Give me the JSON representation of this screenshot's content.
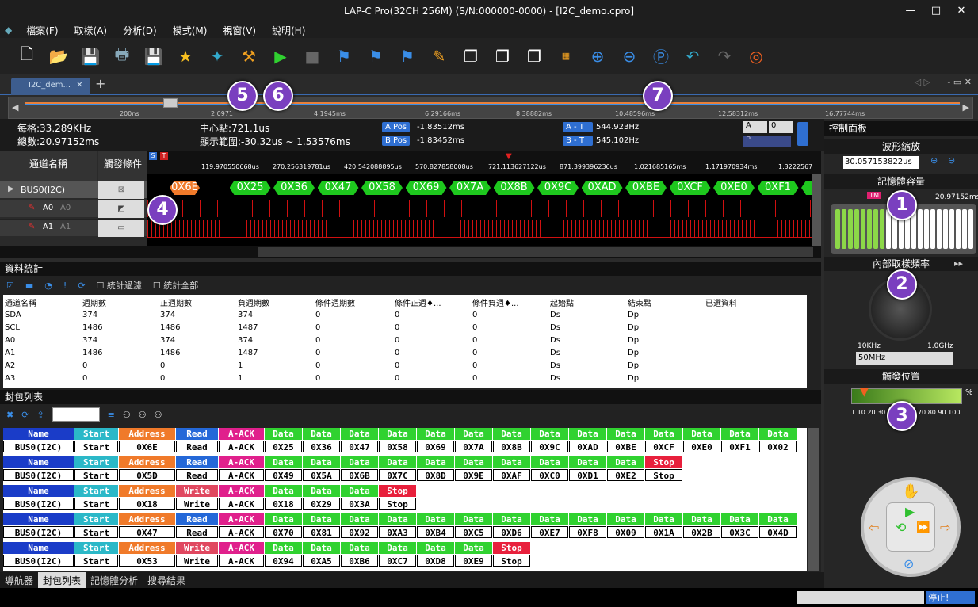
{
  "window": {
    "title": "LAP-C Pro(32CH 256M) (S/N:000000-0000) - [I2C_demo.cpro]",
    "min": "—",
    "max": "□",
    "close": "✕"
  },
  "menu": [
    "檔案(F)",
    "取樣(A)",
    "分析(D)",
    "模式(M)",
    "視窗(V)",
    "說明(H)"
  ],
  "tab": {
    "label": "I2C_dem...",
    "close": "✕",
    "add": "+"
  },
  "ruler_top": [
    "200ns",
    "2.0971",
    "4.1945ms",
    "6.29166ms",
    "8.38882ms",
    "10.48596ms",
    "12.58312ms",
    "16.77744ms"
  ],
  "info": {
    "freq_label": "每格:33.289KHz",
    "total_label": "總數:20.97152ms",
    "center_label": "中心點:721.1us",
    "range_label": "顯示範圍:-30.32us ~ 1.53576ms",
    "apos_btn": "A Pos",
    "apos_val": "-1.83512ms",
    "bpos_btn": "B Pos",
    "bpos_val": "-1.83452ms",
    "at_btn": "A - T",
    "at_val": "544.923Hz",
    "bt_btn": "B - T",
    "bt_val": "545.102Hz",
    "sel_a": "A",
    "sel_0": "0",
    "sel_p": "P"
  },
  "channels": {
    "head_name": "通道名稱",
    "head_trigger": "觸發條件",
    "rows": [
      {
        "name": "BUS0(I2C)"
      },
      {
        "name": "A0",
        "sub": "A0"
      },
      {
        "name": "A1",
        "sub": "A1"
      }
    ]
  },
  "wave_ticks": [
    "119.970550668us",
    "270.256319781us",
    "420.542088895us",
    "570.827858008us",
    "721.113627122us",
    "871.399396236us",
    "1.021685165ms",
    "1.171970934ms",
    "1.3222567"
  ],
  "wave_hex": [
    "0X6E",
    "0X25",
    "0X36",
    "0X47",
    "0X58",
    "0X69",
    "0X7A",
    "0X8B",
    "0X9C",
    "0XAD",
    "0XBE",
    "0XCF",
    "0XE0",
    "0XF1",
    "0X0"
  ],
  "stats": {
    "title": "資料統計",
    "opt1": "統計過濾",
    "opt2": "統計全部",
    "headers": [
      "通道名稱",
      "週期數",
      "正週期數",
      "負週期數",
      "條件週期數",
      "條件正週♦...",
      "條件負週♦...",
      "起始點",
      "結束點",
      "已選資料"
    ],
    "rows": [
      [
        "SDA",
        "374",
        "374",
        "374",
        "0",
        "0",
        "0",
        "Ds",
        "Dp"
      ],
      [
        "SCL",
        "1486",
        "1486",
        "1487",
        "0",
        "0",
        "0",
        "Ds",
        "Dp"
      ],
      [
        "A0",
        "374",
        "374",
        "374",
        "0",
        "0",
        "0",
        "Ds",
        "Dp"
      ],
      [
        "A1",
        "1486",
        "1486",
        "1487",
        "0",
        "0",
        "0",
        "Ds",
        "Dp"
      ],
      [
        "A2",
        "0",
        "0",
        "1",
        "0",
        "0",
        "0",
        "Ds",
        "Dp"
      ],
      [
        "A3",
        "0",
        "0",
        "1",
        "0",
        "0",
        "0",
        "Ds",
        "Dp"
      ]
    ]
  },
  "packets": {
    "title": "封包列表",
    "rows": [
      [
        [
          "Name",
          "BUS0(I2C)"
        ],
        [
          "Start",
          "Start"
        ],
        [
          "Address",
          "0X6E"
        ],
        [
          "Read",
          "Read"
        ],
        [
          "A-ACK",
          "A-ACK"
        ],
        [
          "Data",
          "0X25"
        ],
        [
          "Data",
          "0X36"
        ],
        [
          "Data",
          "0X47"
        ],
        [
          "Data",
          "0X58"
        ],
        [
          "Data",
          "0X69"
        ],
        [
          "Data",
          "0X7A"
        ],
        [
          "Data",
          "0X8B"
        ],
        [
          "Data",
          "0X9C"
        ],
        [
          "Data",
          "0XAD"
        ],
        [
          "Data",
          "0XBE"
        ],
        [
          "Data",
          "0XCF"
        ],
        [
          "Data",
          "0XE0"
        ],
        [
          "Data",
          "0XF1"
        ],
        [
          "Data",
          "0X02"
        ]
      ],
      [
        [
          "Name",
          "BUS0(I2C)"
        ],
        [
          "Start",
          "Start"
        ],
        [
          "Address",
          "0X5D"
        ],
        [
          "Read",
          "Read"
        ],
        [
          "A-ACK",
          "A-ACK"
        ],
        [
          "Data",
          "0X49"
        ],
        [
          "Data",
          "0X5A"
        ],
        [
          "Data",
          "0X6B"
        ],
        [
          "Data",
          "0X7C"
        ],
        [
          "Data",
          "0X8D"
        ],
        [
          "Data",
          "0X9E"
        ],
        [
          "Data",
          "0XAF"
        ],
        [
          "Data",
          "0XC0"
        ],
        [
          "Data",
          "0XD1"
        ],
        [
          "Data",
          "0XE2"
        ],
        [
          "Stop",
          "Stop"
        ]
      ],
      [
        [
          "Name",
          "BUS0(I2C)"
        ],
        [
          "Start",
          "Start"
        ],
        [
          "Address",
          "0X18"
        ],
        [
          "Write",
          "Write"
        ],
        [
          "A-ACK",
          "A-ACK"
        ],
        [
          "Data",
          "0X18"
        ],
        [
          "Data",
          "0X29"
        ],
        [
          "Data",
          "0X3A"
        ],
        [
          "Stop",
          "Stop"
        ]
      ],
      [
        [
          "Name",
          "BUS0(I2C)"
        ],
        [
          "Start",
          "Start"
        ],
        [
          "Address",
          "0X47"
        ],
        [
          "Read",
          "Read"
        ],
        [
          "A-ACK",
          "A-ACK"
        ],
        [
          "Data",
          "0X70"
        ],
        [
          "Data",
          "0X81"
        ],
        [
          "Data",
          "0X92"
        ],
        [
          "Data",
          "0XA3"
        ],
        [
          "Data",
          "0XB4"
        ],
        [
          "Data",
          "0XC5"
        ],
        [
          "Data",
          "0XD6"
        ],
        [
          "Data",
          "0XE7"
        ],
        [
          "Data",
          "0XF8"
        ],
        [
          "Data",
          "0X09"
        ],
        [
          "Data",
          "0X1A"
        ],
        [
          "Data",
          "0X2B"
        ],
        [
          "Data",
          "0X3C"
        ],
        [
          "Data",
          "0X4D"
        ]
      ],
      [
        [
          "Name",
          "BUS0(I2C)"
        ],
        [
          "Start",
          "Start"
        ],
        [
          "Address",
          "0X53"
        ],
        [
          "Write",
          "Write"
        ],
        [
          "A-ACK",
          "A-ACK"
        ],
        [
          "Data",
          "0X94"
        ],
        [
          "Data",
          "0XA5"
        ],
        [
          "Data",
          "0XB6"
        ],
        [
          "Data",
          "0XC7"
        ],
        [
          "Data",
          "0XD8"
        ],
        [
          "Data",
          "0XE9"
        ],
        [
          "Stop",
          "Stop"
        ]
      ]
    ]
  },
  "bottom_tabs": [
    "導航器",
    "封包列表",
    "記憶體分析",
    "搜尋結果"
  ],
  "status": "停止!",
  "control": {
    "title": "控制面板",
    "zoom_title": "波形縮放",
    "zoom_value": "30.057153822us",
    "mem_title": "記憶體容量",
    "mem_marker": "1M",
    "mem_total": "20.97152ms",
    "rate_title": "內部取樣頻率",
    "rate_min": "10KHz",
    "rate_max": "1.0GHz",
    "rate_value": "50MHz",
    "trig_title": "觸發位置",
    "trig_scale": "1 10 20 30 40 50 60 70 80 90 100",
    "trig_pct": "%"
  },
  "badges": [
    "1",
    "2",
    "3",
    "4",
    "5",
    "6",
    "7"
  ],
  "colors": {
    "Name": "#1a3cc8",
    "Start": "#2bb8c8",
    "Address": "#f07a2a",
    "Read": "#2468d8",
    "Write": "#e04860",
    "A-ACK": "#e0208c",
    "Data": "#30d230",
    "Stop": "#e8203c"
  }
}
